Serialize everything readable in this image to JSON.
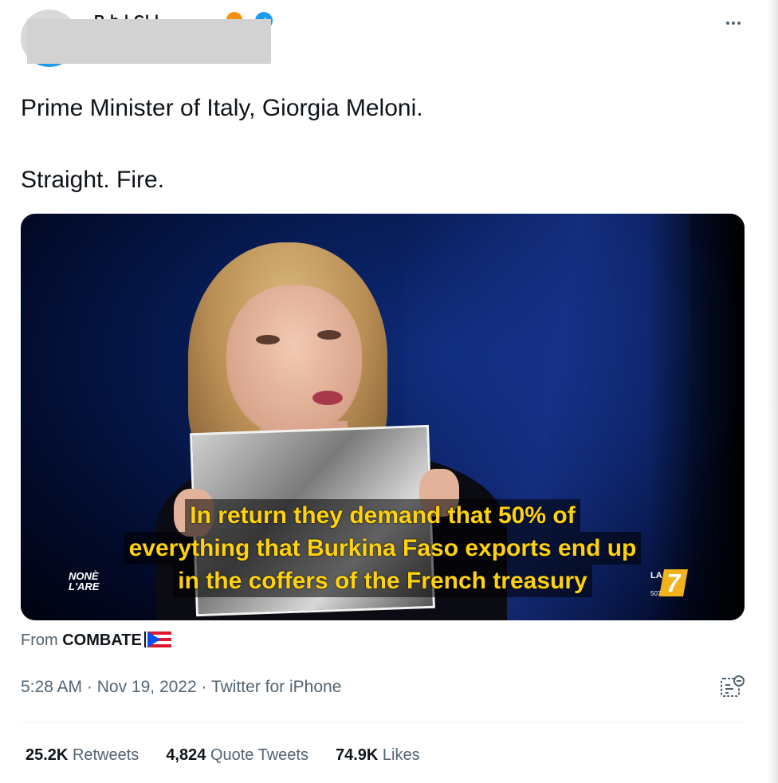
{
  "header": {
    "name_fragment": "R b   l  Cl  l",
    "more_icon": "more-horizontal-icon"
  },
  "tweet": {
    "line1": "Prime Minister of Italy, Giorgia Meloni.",
    "line2": "Straight. Fire."
  },
  "media": {
    "subtitle_line1": "In return they demand that 50% of",
    "subtitle_line2": "everything that Burkina Faso exports end up",
    "subtitle_line3": "in the coffers of the French treasury",
    "logo_left_line1": "NONÈ",
    "logo_left_line2": "L'ARE",
    "logo_right_la": "LA",
    "logo_right_seven": "7",
    "logo_right_num": "507"
  },
  "source": {
    "prefix": "From",
    "name": "COMBATE"
  },
  "meta": {
    "time": "5:28 AM",
    "date": "Nov 19, 2022",
    "client": "Twitter for iPhone",
    "separator": " · "
  },
  "stats": {
    "retweets_count": "25.2K",
    "retweets_label": "Retweets",
    "quotes_count": "4,824",
    "quotes_label": "Quote Tweets",
    "likes_count": "74.9K",
    "likes_label": "Likes"
  },
  "colors": {
    "subtitle": "#ffd20a",
    "secondary_text": "#536471",
    "primary_text": "#0f1419",
    "verified": "#1d9bf0"
  }
}
